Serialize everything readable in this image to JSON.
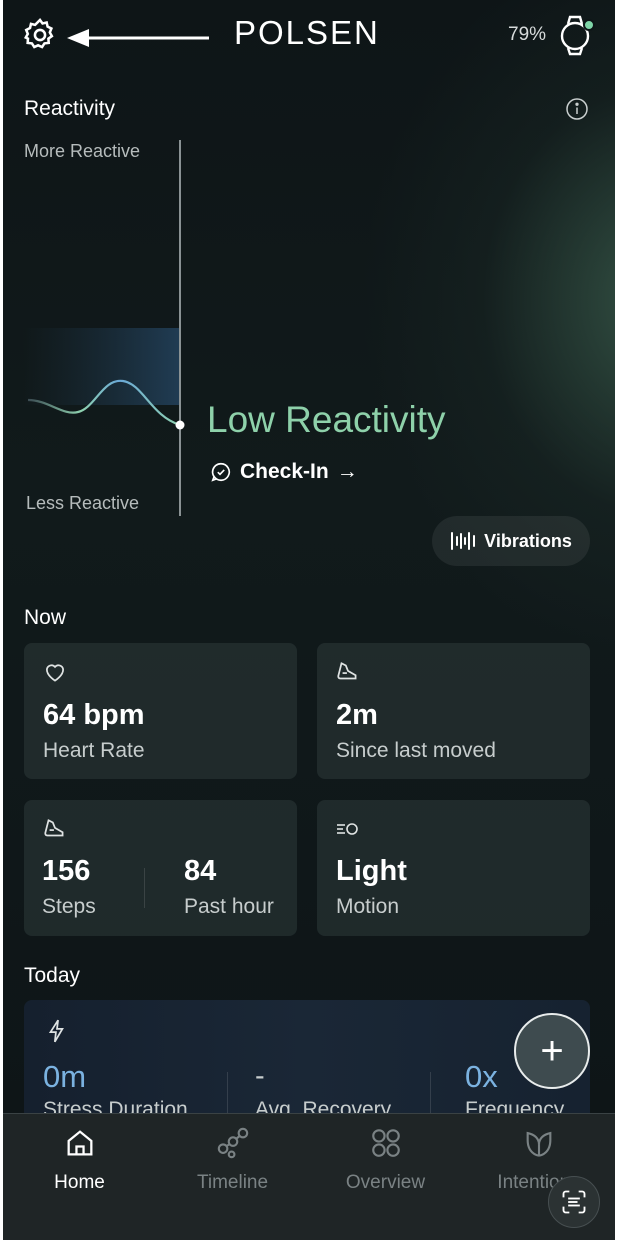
{
  "header": {
    "brand": "POLSEN",
    "battery": "79%",
    "settings_icon": "gear-icon",
    "arrow_icon": "arrow-left-icon",
    "watch_icon": "watch-icon",
    "watch_status_color": "#7fd6a8"
  },
  "reactivity": {
    "title": "Reactivity",
    "info_icon": "info-icon",
    "axis_top": "More Reactive",
    "axis_bottom": "Less Reactive",
    "status": "Low Reactivity",
    "status_color": "#8ed1aa",
    "checkin_label": "Check-In",
    "checkin_arrow": "→",
    "vibrations_label": "Vibrations"
  },
  "now": {
    "title": "Now",
    "cards": [
      {
        "icon": "heart-icon",
        "value": "64 bpm",
        "label": "Heart Rate"
      },
      {
        "icon": "shoe-icon",
        "value": "2m",
        "label": "Since last moved"
      },
      {
        "icon": "shoe-icon",
        "value": "156",
        "label": "Steps",
        "value2": "84",
        "label2": "Past hour"
      },
      {
        "icon": "motion-icon",
        "value": "Light",
        "label": "Motion"
      }
    ]
  },
  "today": {
    "title": "Today",
    "icon": "lightning-icon",
    "stats": [
      {
        "value": "0m",
        "label": "Stress Duration"
      },
      {
        "value": "-",
        "label": "Avg. Recovery"
      },
      {
        "value": "0x",
        "label": "Frequency"
      }
    ],
    "accent_color": "#7bb2e0"
  },
  "fab": {
    "label": "+"
  },
  "nav": {
    "items": [
      {
        "label": "Home",
        "icon": "home-icon",
        "active": true
      },
      {
        "label": "Timeline",
        "icon": "timeline-icon"
      },
      {
        "label": "Overview",
        "icon": "overview-icon"
      },
      {
        "label": "Intentions",
        "icon": "leaf-icon"
      }
    ],
    "scan_icon": "scan-icon"
  }
}
